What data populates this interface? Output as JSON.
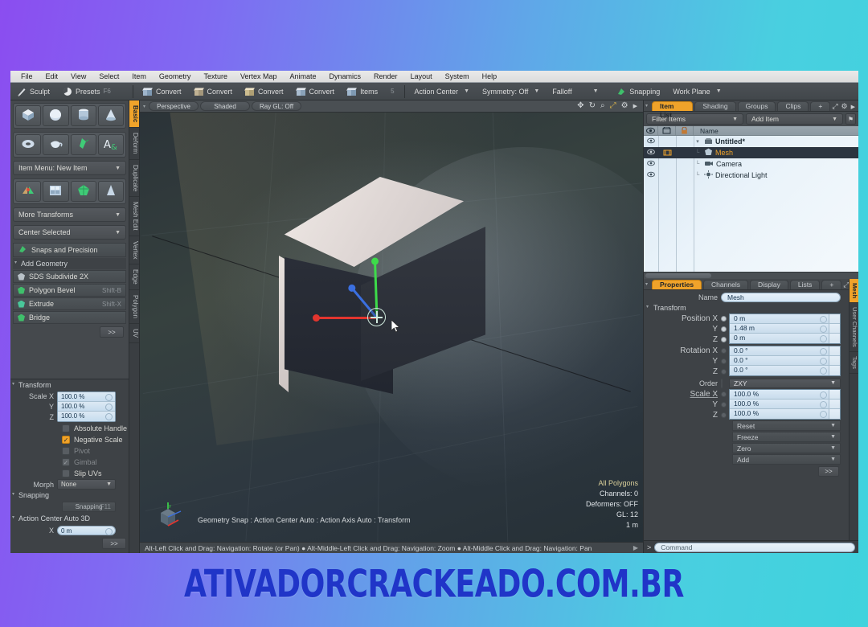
{
  "watermark": "ATIVADORCRACKEADO.COM.BR",
  "menubar": {
    "items": [
      "File",
      "Edit",
      "View",
      "Select",
      "Item",
      "Geometry",
      "Texture",
      "Vertex Map",
      "Animate",
      "Dynamics",
      "Render",
      "Layout",
      "System",
      "Help"
    ]
  },
  "toolbar": {
    "sculpt": "Sculpt",
    "presets": "Presets",
    "presets_shortcut": "F6",
    "convert": [
      "Convert",
      "Convert",
      "Convert",
      "Convert"
    ],
    "items": "Items",
    "items_count": "5",
    "action_center": "Action Center",
    "symmetry": "Symmetry: Off",
    "falloff": "Falloff",
    "snapping": "Snapping",
    "work_plane": "Work Plane"
  },
  "left_panel": {
    "primitives_row1": [
      "cube-icon",
      "sphere-icon",
      "cylinder-icon",
      "cone-icon"
    ],
    "primitives_row2": [
      "torus-icon",
      "teapot-icon",
      "pen-icon",
      "text-icon"
    ],
    "item_menu": "Item Menu: New Item",
    "tools_row": [
      "mirror-icon",
      "array-icon",
      "gem-icon",
      "taper-icon"
    ],
    "more_transforms": "More Transforms",
    "center_selected": "Center Selected",
    "snaps_and_precision": "Snaps and Precision",
    "add_geometry": "Add Geometry",
    "commands": [
      {
        "label": "SDS Subdivide 2X",
        "shortcut": ""
      },
      {
        "label": "Polygon Bevel",
        "shortcut": "Shift-B"
      },
      {
        "label": "Extrude",
        "shortcut": "Shift-X"
      },
      {
        "label": "Bridge",
        "shortcut": ""
      }
    ],
    "more_button": ">>",
    "vtabs": [
      "Basic",
      "Deform",
      "Duplicate",
      "Mesh Edit",
      "Vertex",
      "Edge",
      "Polygon",
      "UV"
    ],
    "vtab_active": "Basic",
    "transform": {
      "title": "Transform",
      "scale_label": "Scale X",
      "scale": [
        {
          "axis": "Scale X",
          "value": "100.0 %"
        },
        {
          "axis": "Y",
          "value": "100.0 %"
        },
        {
          "axis": "Z",
          "value": "100.0 %"
        }
      ],
      "checks": [
        {
          "label": "Absolute Handle",
          "state": "off",
          "dim": false
        },
        {
          "label": "Negative Scale",
          "state": "on",
          "dim": false
        },
        {
          "label": "Pivot",
          "state": "off",
          "dim": true
        },
        {
          "label": "Gimbal",
          "state": "halfon",
          "dim": true
        },
        {
          "label": "Slip UVs",
          "state": "off",
          "dim": false
        }
      ],
      "morph_label": "Morph",
      "morph_value": "None"
    },
    "snapping_section": "Snapping",
    "snapping_button": "Snapping",
    "snapping_shortcut": "F11",
    "action_center_section": "Action Center Auto 3D",
    "acx_label": "X",
    "acx_value": "0 m"
  },
  "viewport": {
    "perspective": "Perspective",
    "shaded": "Shaded",
    "raygl": "Ray GL: Off",
    "header_icons": [
      "move-icon",
      "rotate-icon",
      "zoom-icon",
      "fit-icon",
      "gear-icon",
      "chevron-right-icon"
    ],
    "status_line": "Geometry Snap : Action Center Auto : Action Axis Auto : Transform",
    "stats": [
      {
        "label": "All Polygons",
        "type": "mode"
      },
      {
        "label": "Channels: 0",
        "type": "info"
      },
      {
        "label": "Deformers: OFF",
        "type": "info"
      },
      {
        "label": "GL: 12",
        "type": "info"
      },
      {
        "label": "1 m",
        "type": "info"
      }
    ],
    "hint": "Alt-Left Click and Drag: Navigation: Rotate (or Pan) ● Alt-Middle-Left Click and Drag: Navigation: Zoom ● Alt-Middle Click and Drag: Navigation: Pan",
    "gizmo": {
      "x_color": "#e2352e",
      "y_color": "#3ddb4a",
      "z_color": "#3b6fe0"
    }
  },
  "item_list": {
    "tabs": [
      "Item List",
      "Shading",
      "Groups",
      "Clips",
      "+"
    ],
    "tab_active": "Item List",
    "filter_placeholder": "Filter Items",
    "add_item": "Add Item",
    "columns": [
      "visibility-col",
      "render-col",
      "lock-col",
      "Name"
    ],
    "name_header": "Name",
    "rows": [
      {
        "name": "Untitled*",
        "indent": 0,
        "icon": "scene-icon",
        "selected": false,
        "expander": "▾"
      },
      {
        "name": "Mesh",
        "indent": 1,
        "icon": "mesh-icon",
        "selected": true,
        "expander": ""
      },
      {
        "name": "Camera",
        "indent": 1,
        "icon": "camera-icon",
        "selected": false,
        "expander": ""
      },
      {
        "name": "Directional Light",
        "indent": 1,
        "icon": "light-icon",
        "selected": false,
        "expander": ""
      }
    ]
  },
  "properties": {
    "tabs": [
      "Properties",
      "Channels",
      "Display",
      "Lists",
      "+"
    ],
    "tab_active": "Properties",
    "name_label": "Name",
    "name_value": "Mesh",
    "transform_title": "Transform",
    "position": [
      {
        "label": "Position X",
        "value": "0 m"
      },
      {
        "label": "Y",
        "value": "1.48 m"
      },
      {
        "label": "Z",
        "value": "0 m"
      }
    ],
    "rotation": [
      {
        "label": "Rotation X",
        "value": "0.0 °"
      },
      {
        "label": "Y",
        "value": "0.0 °"
      },
      {
        "label": "Z",
        "value": "0.0 °"
      }
    ],
    "order_label": "Order",
    "order_value": "ZXY",
    "scale": [
      {
        "label": "Scale X",
        "value": "100.0 %"
      },
      {
        "label": "Y",
        "value": "100.0 %"
      },
      {
        "label": "Z",
        "value": "100.0 %"
      }
    ],
    "actions": [
      "Reset",
      "Freeze",
      "Zero",
      "Add"
    ],
    "more_button": ">>",
    "vtabs": [
      "Mesh",
      "User Channels",
      "Tags"
    ],
    "vtab_active": "Mesh"
  },
  "command_bar": {
    "prompt": ">",
    "placeholder": "Command"
  }
}
